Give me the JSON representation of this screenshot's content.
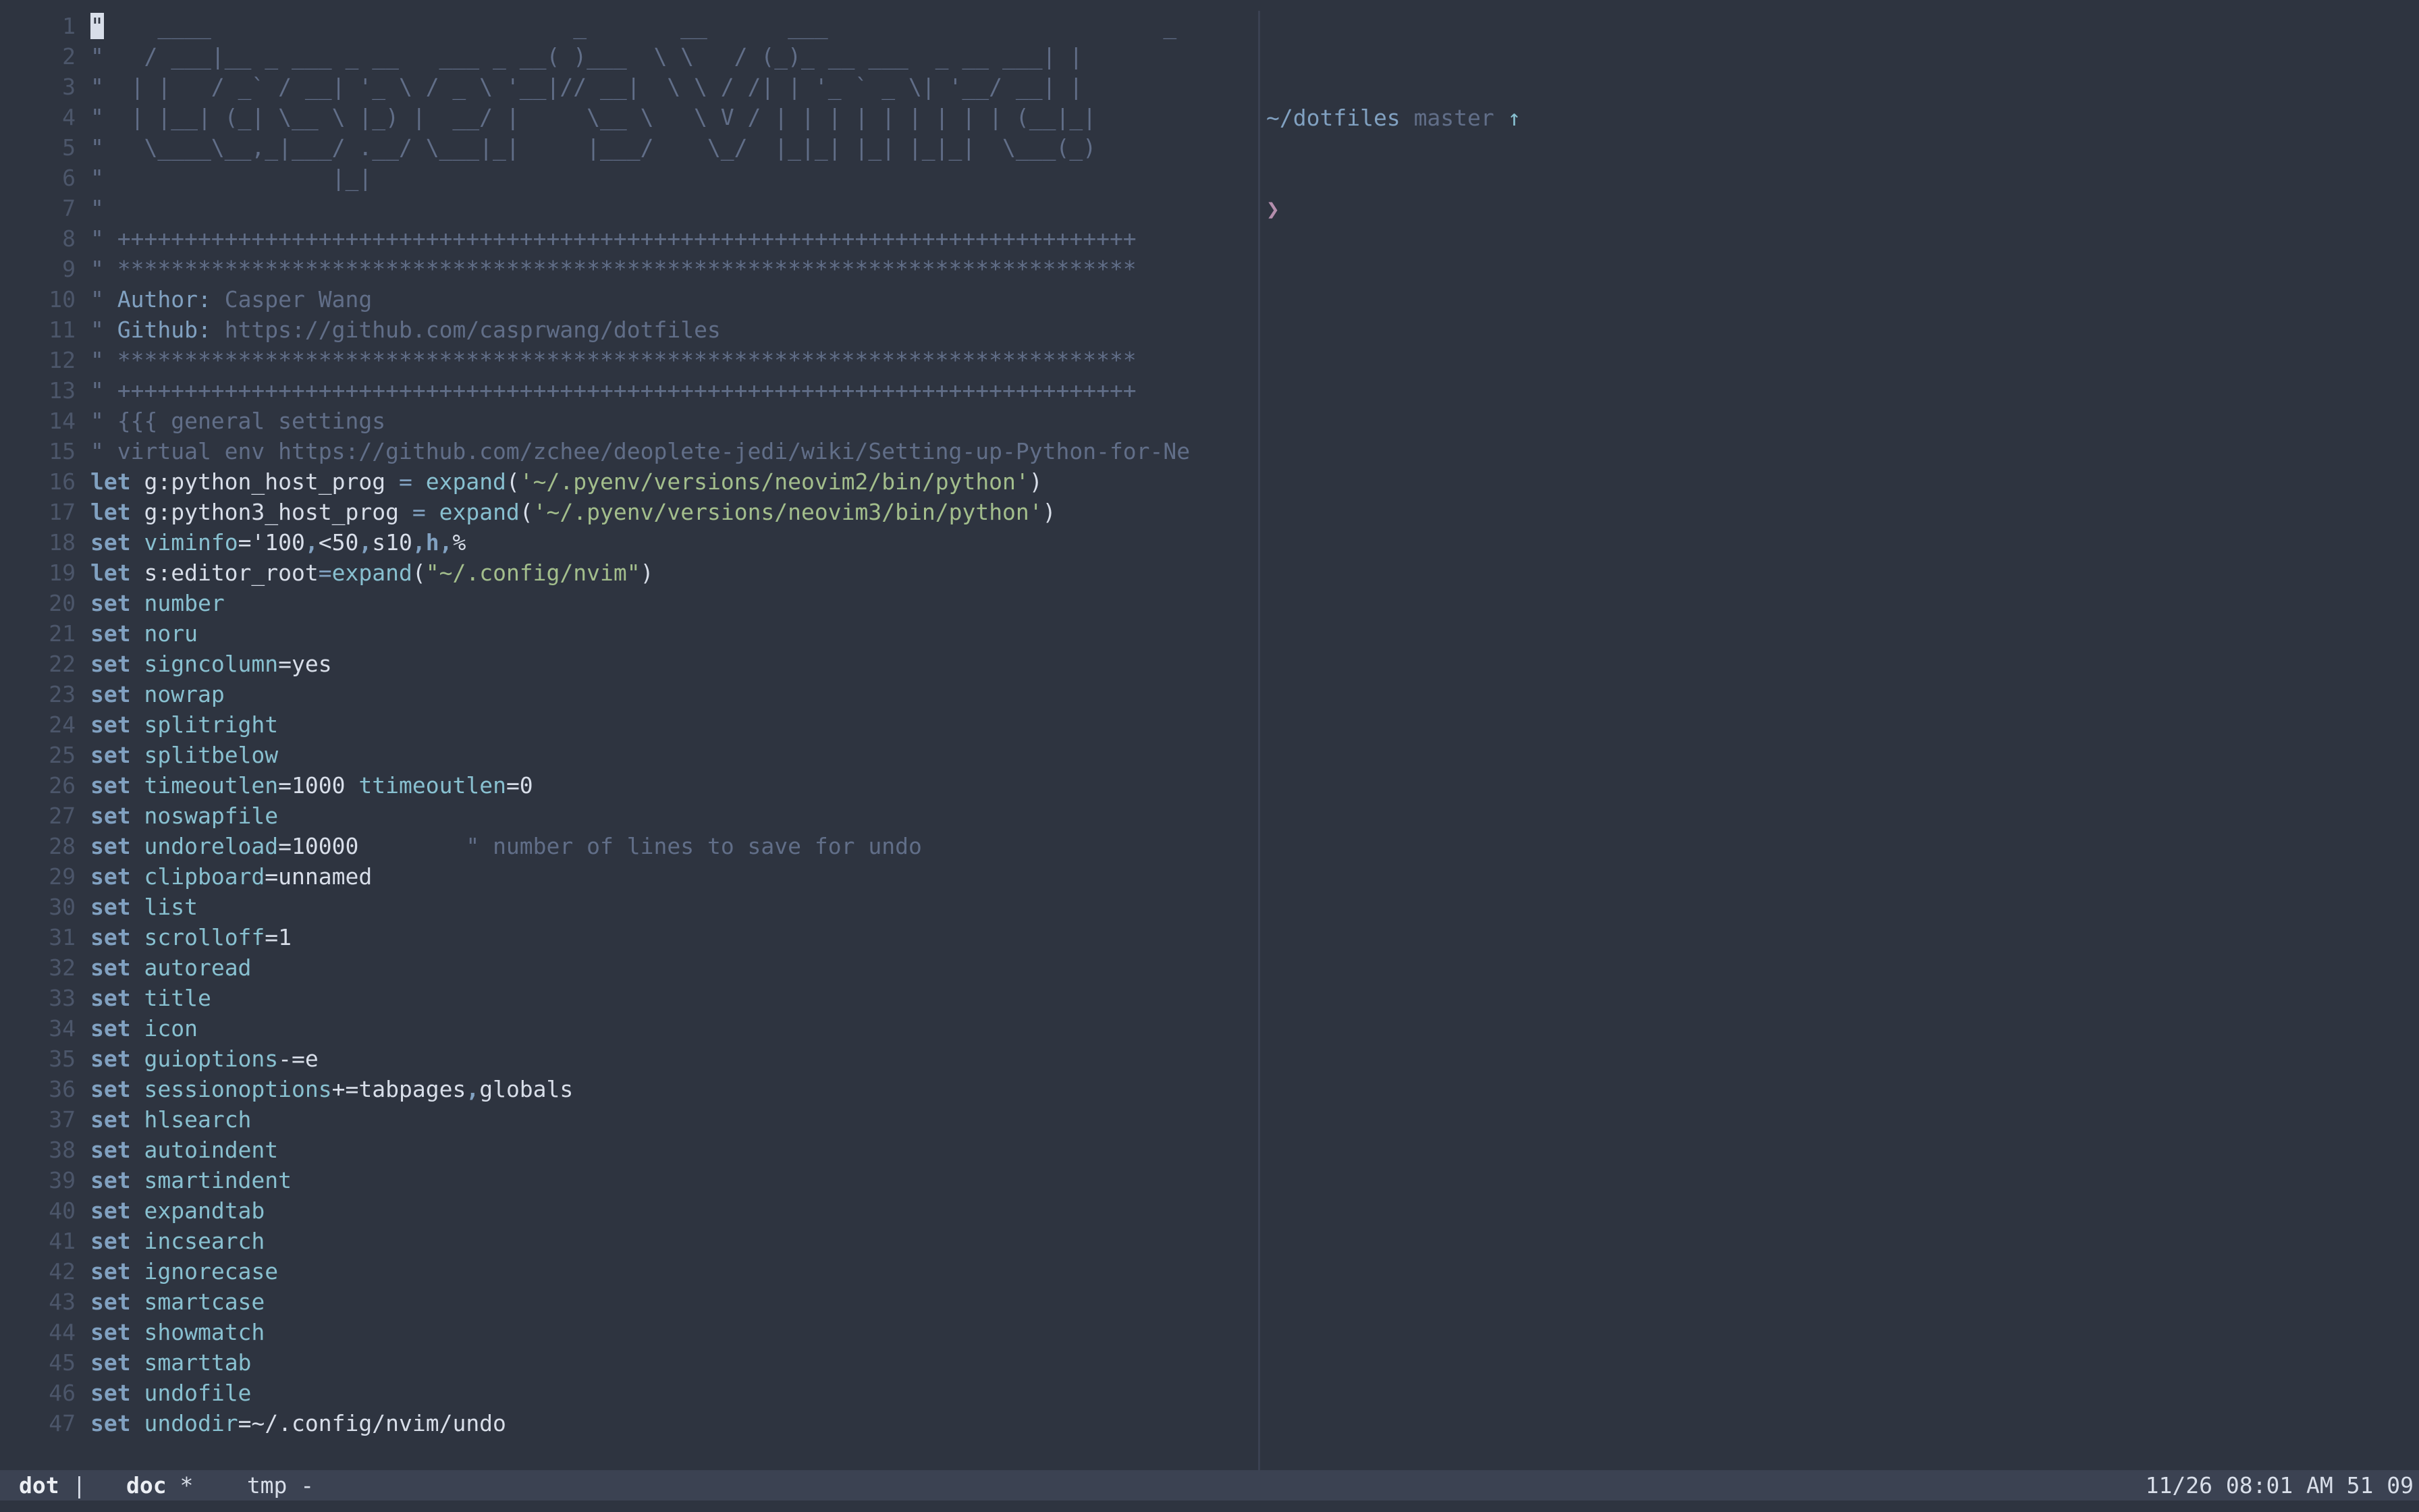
{
  "editor": {
    "lines": [
      {
        "n": "1",
        "segs": [
          {
            "t": "\"",
            "c": "cursor"
          },
          {
            "t": "    ____                           _       __      ___                         _",
            "c": "comment"
          }
        ]
      },
      {
        "n": "2",
        "segs": [
          {
            "t": "\"   / ___|__ _ ___ _ __   ___ _ __( )___  \\ \\   / (_)_ __ ___  _ __ ___| |",
            "c": "comment"
          }
        ]
      },
      {
        "n": "3",
        "segs": [
          {
            "t": "\"  | |   / _` / __| '_ \\ / _ \\ '__|// __|  \\ \\ / /| | '_ ` _ \\| '__/ __| |",
            "c": "comment"
          }
        ]
      },
      {
        "n": "4",
        "segs": [
          {
            "t": "\"  | |__| (_| \\__ \\ |_) |  __/ |     \\__ \\   \\ V / | | | | | | | | | (__|_|",
            "c": "comment"
          }
        ]
      },
      {
        "n": "5",
        "segs": [
          {
            "t": "\"   \\____\\__,_|___/ .__/ \\___|_|     |___/    \\_/  |_|_| |_| |_|_|  \\___(_)",
            "c": "comment"
          }
        ]
      },
      {
        "n": "6",
        "segs": [
          {
            "t": "\"                 |_|",
            "c": "comment"
          }
        ]
      },
      {
        "n": "7",
        "segs": [
          {
            "t": "\"",
            "c": "comment"
          }
        ]
      },
      {
        "n": "8",
        "segs": [
          {
            "t": "\" ++++++++++++++++++++++++++++++++++++++++++++++++++++++++++++++++++++++++++++",
            "c": "comment"
          }
        ]
      },
      {
        "n": "9",
        "segs": [
          {
            "t": "\" ****************************************************************************",
            "c": "comment"
          }
        ]
      },
      {
        "n": "10",
        "segs": [
          {
            "t": "\" ",
            "c": "comment"
          },
          {
            "t": "Author:",
            "c": "cmt-key"
          },
          {
            "t": " Casper Wang",
            "c": "comment"
          }
        ]
      },
      {
        "n": "11",
        "segs": [
          {
            "t": "\" ",
            "c": "comment"
          },
          {
            "t": "Github:",
            "c": "cmt-key"
          },
          {
            "t": " https://github.com/casprwang/dotfiles",
            "c": "comment"
          }
        ]
      },
      {
        "n": "12",
        "segs": [
          {
            "t": "\" ****************************************************************************",
            "c": "comment"
          }
        ]
      },
      {
        "n": "13",
        "segs": [
          {
            "t": "\" ++++++++++++++++++++++++++++++++++++++++++++++++++++++++++++++++++++++++++++",
            "c": "comment"
          }
        ]
      },
      {
        "n": "14",
        "segs": [
          {
            "t": "\" {{{ general settings",
            "c": "comment"
          }
        ]
      },
      {
        "n": "15",
        "segs": [
          {
            "t": "\" virtual env https://github.com/zchee/deoplete-jedi/wiki/Setting-up-Python-for-Ne",
            "c": "comment"
          }
        ]
      },
      {
        "n": "16",
        "segs": [
          {
            "t": "let",
            "c": "kw"
          },
          {
            "t": " g:python_host_prog ",
            "c": "plain"
          },
          {
            "t": "=",
            "c": "op"
          },
          {
            "t": " ",
            "c": "plain"
          },
          {
            "t": "expand",
            "c": "fn"
          },
          {
            "t": "(",
            "c": "plain"
          },
          {
            "t": "'~/.pyenv/versions/neovim2/bin/python'",
            "c": "str"
          },
          {
            "t": ")",
            "c": "plain"
          }
        ]
      },
      {
        "n": "17",
        "segs": [
          {
            "t": "let",
            "c": "kw"
          },
          {
            "t": " g:python3_host_prog ",
            "c": "plain"
          },
          {
            "t": "=",
            "c": "op"
          },
          {
            "t": " ",
            "c": "plain"
          },
          {
            "t": "expand",
            "c": "fn"
          },
          {
            "t": "(",
            "c": "plain"
          },
          {
            "t": "'~/.pyenv/versions/neovim3/bin/python'",
            "c": "str"
          },
          {
            "t": ")",
            "c": "plain"
          }
        ]
      },
      {
        "n": "18",
        "segs": [
          {
            "t": "set",
            "c": "kw"
          },
          {
            "t": " ",
            "c": "plain"
          },
          {
            "t": "viminfo",
            "c": "opt"
          },
          {
            "t": "='100",
            "c": "plain"
          },
          {
            "t": ",",
            "c": "kw"
          },
          {
            "t": "<50",
            "c": "plain"
          },
          {
            "t": ",",
            "c": "kw"
          },
          {
            "t": "s10",
            "c": "plain"
          },
          {
            "t": ",h,",
            "c": "kw"
          },
          {
            "t": "%",
            "c": "plain"
          }
        ]
      },
      {
        "n": "19",
        "segs": [
          {
            "t": "let",
            "c": "kw"
          },
          {
            "t": " s:editor_root",
            "c": "plain"
          },
          {
            "t": "=",
            "c": "op"
          },
          {
            "t": "expand",
            "c": "fn"
          },
          {
            "t": "(",
            "c": "plain"
          },
          {
            "t": "\"~/.config/nvim\"",
            "c": "str"
          },
          {
            "t": ")",
            "c": "plain"
          }
        ]
      },
      {
        "n": "20",
        "segs": [
          {
            "t": "set",
            "c": "kw"
          },
          {
            "t": " ",
            "c": "plain"
          },
          {
            "t": "number",
            "c": "opt"
          }
        ]
      },
      {
        "n": "21",
        "segs": [
          {
            "t": "set",
            "c": "kw"
          },
          {
            "t": " ",
            "c": "plain"
          },
          {
            "t": "noru",
            "c": "opt"
          }
        ]
      },
      {
        "n": "22",
        "segs": [
          {
            "t": "set",
            "c": "kw"
          },
          {
            "t": " ",
            "c": "plain"
          },
          {
            "t": "signcolumn",
            "c": "opt"
          },
          {
            "t": "=yes",
            "c": "plain"
          }
        ]
      },
      {
        "n": "23",
        "segs": [
          {
            "t": "set",
            "c": "kw"
          },
          {
            "t": " ",
            "c": "plain"
          },
          {
            "t": "nowrap",
            "c": "opt"
          }
        ]
      },
      {
        "n": "24",
        "segs": [
          {
            "t": "set",
            "c": "kw"
          },
          {
            "t": " ",
            "c": "plain"
          },
          {
            "t": "splitright",
            "c": "opt"
          }
        ]
      },
      {
        "n": "25",
        "segs": [
          {
            "t": "set",
            "c": "kw"
          },
          {
            "t": " ",
            "c": "plain"
          },
          {
            "t": "splitbelow",
            "c": "opt"
          }
        ]
      },
      {
        "n": "26",
        "segs": [
          {
            "t": "set",
            "c": "kw"
          },
          {
            "t": " ",
            "c": "plain"
          },
          {
            "t": "timeoutlen",
            "c": "opt"
          },
          {
            "t": "=1000 ",
            "c": "plain"
          },
          {
            "t": "ttimeoutlen",
            "c": "opt"
          },
          {
            "t": "=0",
            "c": "plain"
          }
        ]
      },
      {
        "n": "27",
        "segs": [
          {
            "t": "set",
            "c": "kw"
          },
          {
            "t": " ",
            "c": "plain"
          },
          {
            "t": "noswapfile",
            "c": "opt"
          }
        ]
      },
      {
        "n": "28",
        "segs": [
          {
            "t": "set",
            "c": "kw"
          },
          {
            "t": " ",
            "c": "plain"
          },
          {
            "t": "undoreload",
            "c": "opt"
          },
          {
            "t": "=10000        ",
            "c": "plain"
          },
          {
            "t": "\" number of lines to save for undo",
            "c": "comment"
          }
        ]
      },
      {
        "n": "29",
        "segs": [
          {
            "t": "set",
            "c": "kw"
          },
          {
            "t": " ",
            "c": "plain"
          },
          {
            "t": "clipboard",
            "c": "opt"
          },
          {
            "t": "=unnamed",
            "c": "plain"
          }
        ]
      },
      {
        "n": "30",
        "segs": [
          {
            "t": "set",
            "c": "kw"
          },
          {
            "t": " ",
            "c": "plain"
          },
          {
            "t": "list",
            "c": "opt"
          }
        ]
      },
      {
        "n": "31",
        "segs": [
          {
            "t": "set",
            "c": "kw"
          },
          {
            "t": " ",
            "c": "plain"
          },
          {
            "t": "scrolloff",
            "c": "opt"
          },
          {
            "t": "=1",
            "c": "plain"
          }
        ]
      },
      {
        "n": "32",
        "segs": [
          {
            "t": "set",
            "c": "kw"
          },
          {
            "t": " ",
            "c": "plain"
          },
          {
            "t": "autoread",
            "c": "opt"
          }
        ]
      },
      {
        "n": "33",
        "segs": [
          {
            "t": "set",
            "c": "kw"
          },
          {
            "t": " ",
            "c": "plain"
          },
          {
            "t": "title",
            "c": "opt"
          }
        ]
      },
      {
        "n": "34",
        "segs": [
          {
            "t": "set",
            "c": "kw"
          },
          {
            "t": " ",
            "c": "plain"
          },
          {
            "t": "icon",
            "c": "opt"
          }
        ]
      },
      {
        "n": "35",
        "segs": [
          {
            "t": "set",
            "c": "kw"
          },
          {
            "t": " ",
            "c": "plain"
          },
          {
            "t": "guioptions",
            "c": "opt"
          },
          {
            "t": "-=e",
            "c": "plain"
          }
        ]
      },
      {
        "n": "36",
        "segs": [
          {
            "t": "set",
            "c": "kw"
          },
          {
            "t": " ",
            "c": "plain"
          },
          {
            "t": "sessionoptions",
            "c": "opt"
          },
          {
            "t": "+=tabpages",
            "c": "plain"
          },
          {
            "t": ",",
            "c": "kw"
          },
          {
            "t": "globals",
            "c": "plain"
          }
        ]
      },
      {
        "n": "37",
        "segs": [
          {
            "t": "set",
            "c": "kw"
          },
          {
            "t": " ",
            "c": "plain"
          },
          {
            "t": "hlsearch",
            "c": "opt"
          }
        ]
      },
      {
        "n": "38",
        "segs": [
          {
            "t": "set",
            "c": "kw"
          },
          {
            "t": " ",
            "c": "plain"
          },
          {
            "t": "autoindent",
            "c": "opt"
          }
        ]
      },
      {
        "n": "39",
        "segs": [
          {
            "t": "set",
            "c": "kw"
          },
          {
            "t": " ",
            "c": "plain"
          },
          {
            "t": "smartindent",
            "c": "opt"
          }
        ]
      },
      {
        "n": "40",
        "segs": [
          {
            "t": "set",
            "c": "kw"
          },
          {
            "t": " ",
            "c": "plain"
          },
          {
            "t": "expandtab",
            "c": "opt"
          }
        ]
      },
      {
        "n": "41",
        "segs": [
          {
            "t": "set",
            "c": "kw"
          },
          {
            "t": " ",
            "c": "plain"
          },
          {
            "t": "incsearch",
            "c": "opt"
          }
        ]
      },
      {
        "n": "42",
        "segs": [
          {
            "t": "set",
            "c": "kw"
          },
          {
            "t": " ",
            "c": "plain"
          },
          {
            "t": "ignorecase",
            "c": "opt"
          }
        ]
      },
      {
        "n": "43",
        "segs": [
          {
            "t": "set",
            "c": "kw"
          },
          {
            "t": " ",
            "c": "plain"
          },
          {
            "t": "smartcase",
            "c": "opt"
          }
        ]
      },
      {
        "n": "44",
        "segs": [
          {
            "t": "set",
            "c": "kw"
          },
          {
            "t": " ",
            "c": "plain"
          },
          {
            "t": "showmatch",
            "c": "opt"
          }
        ]
      },
      {
        "n": "45",
        "segs": [
          {
            "t": "set",
            "c": "kw"
          },
          {
            "t": " ",
            "c": "plain"
          },
          {
            "t": "smarttab",
            "c": "opt"
          }
        ]
      },
      {
        "n": "46",
        "segs": [
          {
            "t": "set",
            "c": "kw"
          },
          {
            "t": " ",
            "c": "plain"
          },
          {
            "t": "undofile",
            "c": "opt"
          }
        ]
      },
      {
        "n": "47",
        "segs": [
          {
            "t": "set",
            "c": "kw"
          },
          {
            "t": " ",
            "c": "plain"
          },
          {
            "t": "undodir",
            "c": "opt"
          },
          {
            "t": "=~/.config/nvim/undo",
            "c": "plain"
          }
        ]
      }
    ]
  },
  "terminal": {
    "path": "~/dotfiles",
    "branch": "master",
    "git_status_icon": "↑",
    "prompt_symbol": "❯"
  },
  "tmux": {
    "windows": [
      {
        "name": "dot",
        "flag": "|",
        "active": true
      },
      {
        "name": "doc",
        "flag": "*",
        "active": true
      },
      {
        "name": "tmp",
        "flag": "-",
        "active": false
      }
    ],
    "clock": "11/26 08:01 AM 51 09"
  },
  "colors": {
    "background": "#2e3440",
    "status_bar": "#3b4252",
    "comment": "#616e88",
    "keyword": "#81a1c1",
    "option": "#88c0d0",
    "string": "#a3be8c",
    "prompt": "#b48ead"
  }
}
